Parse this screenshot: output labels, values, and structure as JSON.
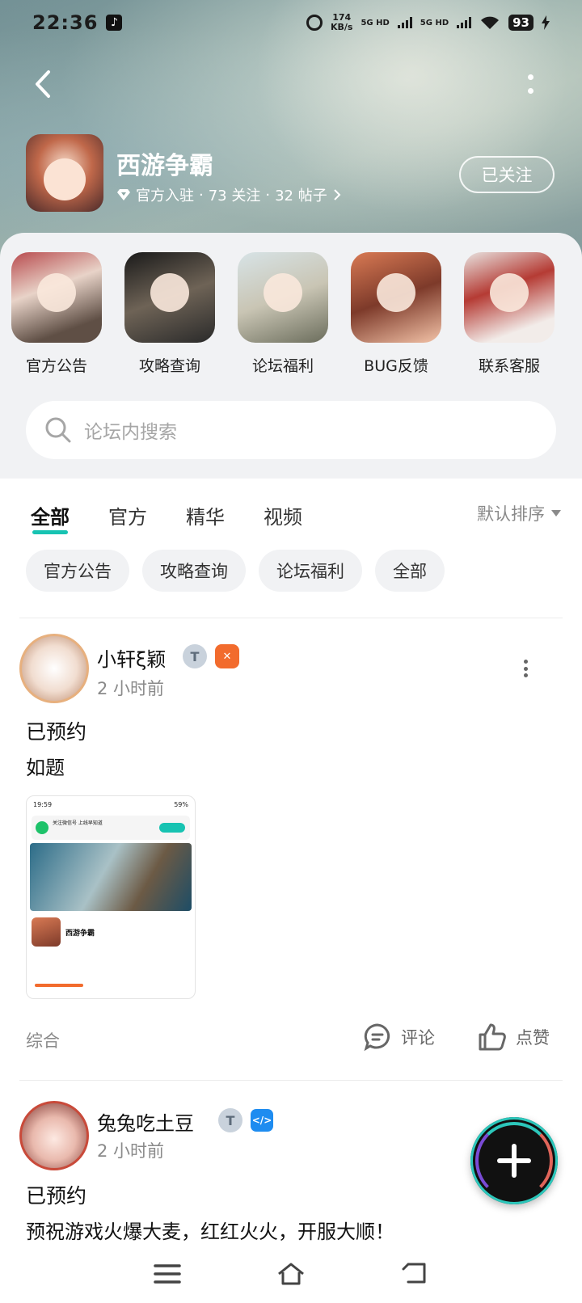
{
  "status_bar": {
    "time": "22:36",
    "net_speed_value": "174",
    "net_speed_unit": "KB/s",
    "sim1_label": "5G HD",
    "sim2_label": "5G HD",
    "battery": "93"
  },
  "header": {
    "game_title": "西游争霸",
    "meta_official": "官方入驻",
    "meta_follows": "73 关注",
    "meta_posts": "32 帖子",
    "follow_button": "已关注"
  },
  "shortcuts": [
    {
      "label": "官方公告"
    },
    {
      "label": "攻略查询"
    },
    {
      "label": "论坛福利"
    },
    {
      "label": "BUG反馈"
    },
    {
      "label": "联系客服"
    }
  ],
  "search": {
    "placeholder": "论坛内搜索"
  },
  "tabs": [
    "全部",
    "官方",
    "精华",
    "视频"
  ],
  "sort_label": "默认排序",
  "chips": [
    "官方公告",
    "攻略查询",
    "论坛福利",
    "全部"
  ],
  "posts": [
    {
      "username": "小轩ξ颖",
      "time": "2 小时前",
      "title": "已预约",
      "body": "如题",
      "image": {
        "status_time": "19:59",
        "status_battery": "59%",
        "notice_text": "关注微信号 上线早知道",
        "notice_button": "去关注",
        "game_name": "西游争霸"
      },
      "category": "综合",
      "comment_label": "评论",
      "like_label": "点赞"
    },
    {
      "username": "兔兔吃土豆",
      "time": "2 小时前",
      "title": "已预约",
      "body": "预祝游戏火爆大麦，红红火火，开服大顺！"
    }
  ],
  "colors": {
    "accent": "#17c3b2",
    "badge_orange": "#f26b2d",
    "badge_blue": "#1e8cf0"
  }
}
